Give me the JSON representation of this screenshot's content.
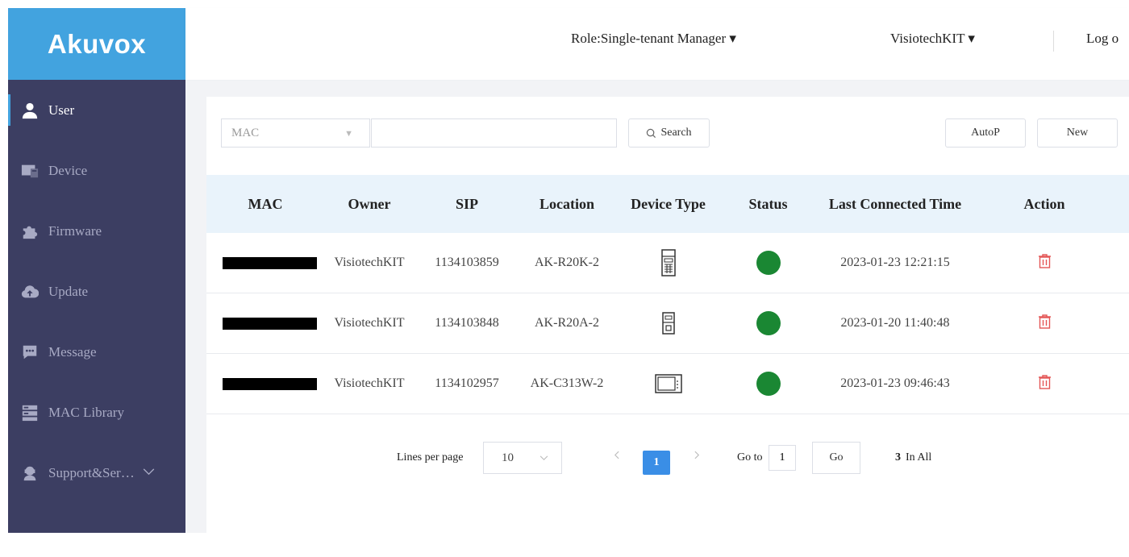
{
  "brand": {
    "logo": "Akuvox",
    "color": "#42a3df"
  },
  "sidebar": {
    "background": "#3c3e62",
    "items": [
      {
        "label": "User",
        "icon": "user-icon",
        "active": true
      },
      {
        "label": "Device",
        "icon": "device-icon",
        "active": false
      },
      {
        "label": "Firmware",
        "icon": "puzzle-icon",
        "active": false
      },
      {
        "label": "Update",
        "icon": "cloud-upload-icon",
        "active": false
      },
      {
        "label": "Message",
        "icon": "chat-icon",
        "active": false
      },
      {
        "label": "MAC Library",
        "icon": "server-icon",
        "active": false
      },
      {
        "label": "Support&Ser…",
        "icon": "support-icon",
        "active": false,
        "expandable": true
      }
    ]
  },
  "header": {
    "role": "Role:Single-tenant Manager ▾",
    "account": "VisiotechKIT ▾",
    "logout": "Log o"
  },
  "toolbar": {
    "filter_value": "MAC",
    "search_value": "",
    "search_label": "Search",
    "autop_label": "AutoP",
    "new_label": "New"
  },
  "table": {
    "columns": [
      "MAC",
      "Owner",
      "SIP",
      "Location",
      "Device Type",
      "Status",
      "Last Connected Time",
      "Action"
    ],
    "rows": [
      {
        "mac": "",
        "owner": "VisiotechKIT",
        "sip": "1134103859",
        "location": "AK-R20K-2",
        "device_type": "keypad-door-phone-icon",
        "status": "online",
        "last_connected": "2023-01-23 12:21:15"
      },
      {
        "mac": "",
        "owner": "VisiotechKIT",
        "sip": "1134103848",
        "location": "AK-R20A-2",
        "device_type": "button-door-phone-icon",
        "status": "online",
        "last_connected": "2023-01-20 11:40:48"
      },
      {
        "mac": "",
        "owner": "VisiotechKIT",
        "sip": "1134102957",
        "location": "AK-C313W-2",
        "device_type": "indoor-monitor-icon",
        "status": "online",
        "last_connected": "2023-01-23 09:46:43"
      }
    ],
    "status_color": "#1a8733",
    "header_bg": "#e9f3fb"
  },
  "pagination": {
    "lines_label": "Lines per page",
    "lines_value": "10",
    "current_page": "1",
    "goto_label": "Go to",
    "goto_value": "1",
    "go_label": "Go",
    "total": "3",
    "total_suffix": "In All",
    "active_color": "#3a8ee6"
  }
}
